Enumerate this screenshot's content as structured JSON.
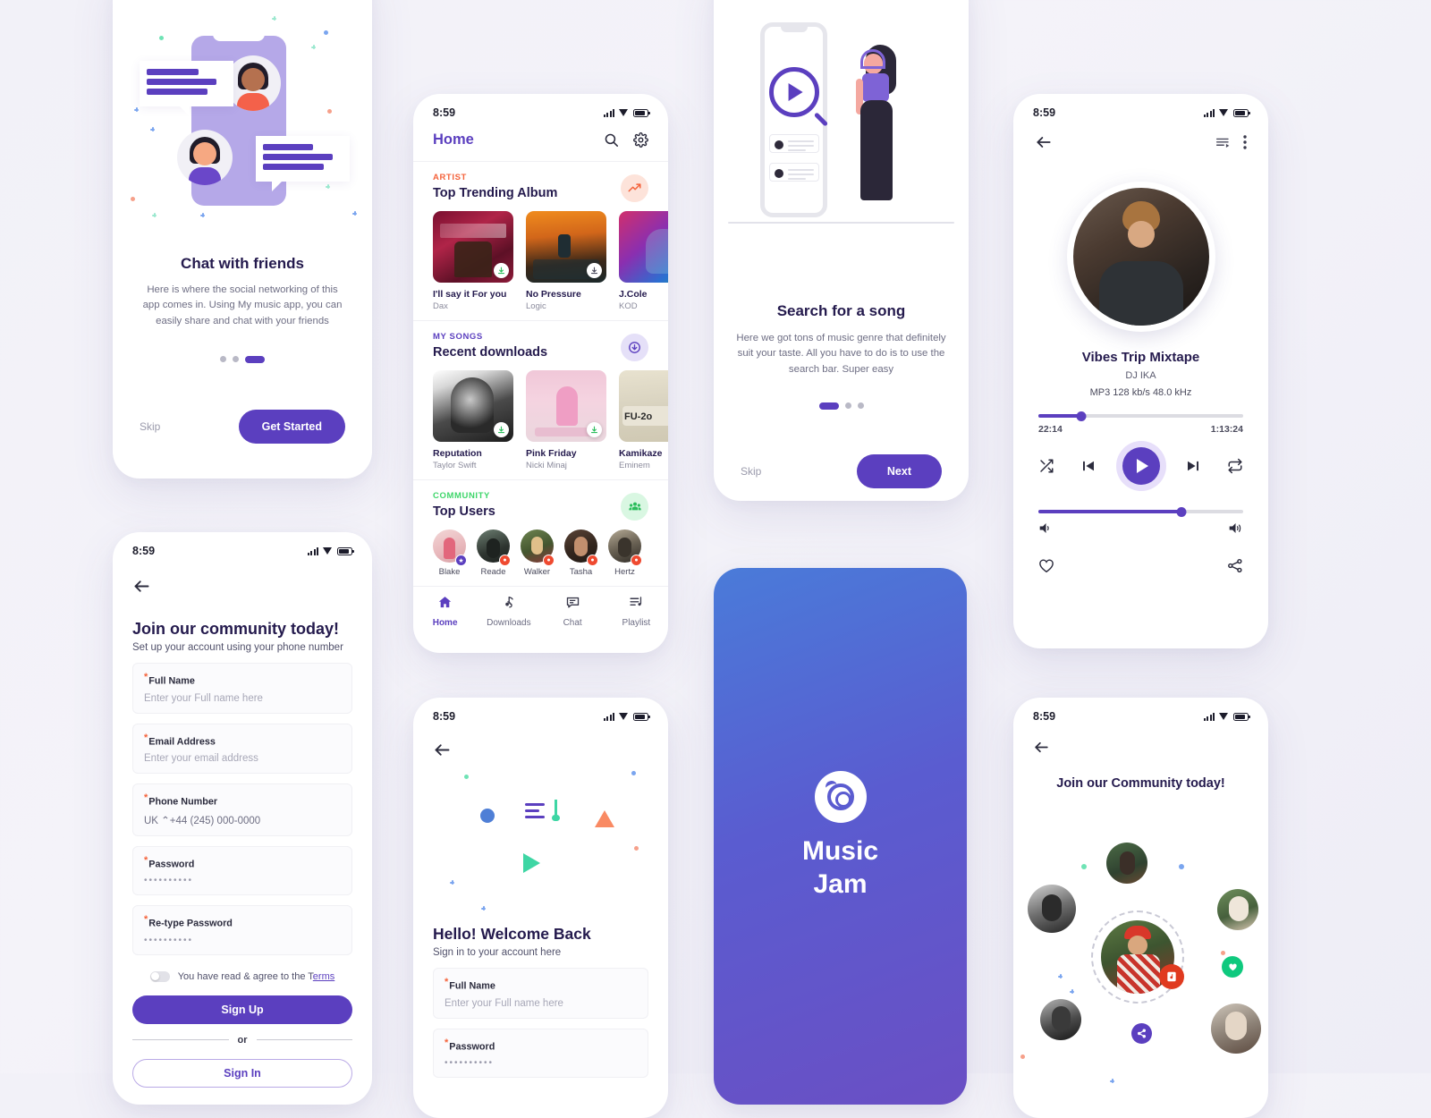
{
  "status_bar": {
    "time": "8:59"
  },
  "onboarding_chat": {
    "title": "Chat with friends",
    "description": "Here is where the social networking of this app comes in. Using My music app, you can easily share and chat with your friends",
    "skip_label": "Skip",
    "cta_label": "Get Started",
    "active_dot_index": 2
  },
  "onboarding_search": {
    "title": "Search for a song",
    "description": "Here we got tons of music genre that definitely suit your taste. All you have to do is to use the search bar. Super easy",
    "skip_label": "Skip",
    "cta_label": "Next",
    "active_dot_index": 0
  },
  "home": {
    "header_title": "Home",
    "sections": [
      {
        "kicker": "ARTIST",
        "kicker_color": "#f4623a",
        "title": "Top Trending Album",
        "badge_icon": "trending-up-icon",
        "badge_bg": "#fde3da",
        "badge_color": "#f4623a",
        "items": [
          {
            "name": "I'll say it For you",
            "artist": "Dax"
          },
          {
            "name": "No Pressure",
            "artist": "Logic"
          },
          {
            "name": "J.Cole",
            "artist": "KOD"
          }
        ]
      },
      {
        "kicker": "MY SONGS",
        "kicker_color": "#5b3fbf",
        "title": "Recent downloads",
        "badge_icon": "download-cloud-icon",
        "badge_bg": "#e5e0f8",
        "badge_color": "#5b3fbf",
        "items": [
          {
            "name": "Reputation",
            "artist": "Taylor Swift"
          },
          {
            "name": "Pink Friday",
            "artist": "Nicki Minaj"
          },
          {
            "name": "Kamikaze",
            "artist": "Eminem"
          }
        ]
      },
      {
        "kicker": "COMMUNITY",
        "kicker_color": "#3ed66a",
        "title": "Top Users",
        "badge_icon": "people-group-icon",
        "badge_bg": "#d9f7e2",
        "badge_color": "#2bbd5c"
      }
    ],
    "top_users": [
      {
        "name": "Blake",
        "badge": "star",
        "badge_color": "#5b3fbf"
      },
      {
        "name": "Reade",
        "badge": "fire",
        "badge_color": "#ef4a30"
      },
      {
        "name": "Walker",
        "badge": "fire",
        "badge_color": "#ef4a30"
      },
      {
        "name": "Tasha",
        "badge": "fire",
        "badge_color": "#ef4a30"
      },
      {
        "name": "Hertz",
        "badge": "fire",
        "badge_color": "#ef4a30"
      }
    ],
    "tabs": [
      {
        "label": "Home",
        "icon": "home-icon",
        "active": true
      },
      {
        "label": "Downloads",
        "icon": "download-music-icon",
        "active": false
      },
      {
        "label": "Chat",
        "icon": "chat-bubble-icon",
        "active": false
      },
      {
        "label": "Playlist",
        "icon": "playlist-icon",
        "active": false
      }
    ]
  },
  "player": {
    "track_title": "Vibes Trip Mixtape",
    "artist": "DJ IKA",
    "format": "MP3 128 kb/s 48.0 kHz",
    "elapsed": "22:14",
    "duration": "1:13:24",
    "progress_percent": 21,
    "volume_percent": 70,
    "icons": {
      "back": "back-arrow-icon",
      "queue": "queue-list-icon",
      "more": "more-vertical-icon",
      "shuffle": "shuffle-icon",
      "previous": "previous-track-icon",
      "play": "play-icon",
      "next": "next-track-icon",
      "repeat": "repeat-icon",
      "volume_low": "volume-low-icon",
      "volume_high": "volume-high-icon",
      "like": "heart-icon",
      "share": "share-icon"
    }
  },
  "signup": {
    "title": "Join our community today!",
    "subtitle": "Set up your account using your phone number",
    "fields": [
      {
        "label": "Full Name",
        "value": "Enter your Full name here",
        "type": "placeholder"
      },
      {
        "label": "Email Address",
        "value": "Enter your email address",
        "type": "placeholder"
      },
      {
        "label": "Phone Number",
        "value": "UK ⌃+44 (245) 000-0000",
        "type": "filled"
      },
      {
        "label": "Password",
        "value": "••••••••••",
        "type": "masked"
      },
      {
        "label": "Re-type Password",
        "value": "••••••••••",
        "type": "masked"
      }
    ],
    "agree_text": "You have read & agree to the T",
    "agree_link": "erms",
    "primary_button": "Sign Up",
    "divider_label": "or",
    "secondary_button": "Sign In"
  },
  "signin": {
    "title": "Hello! Welcome Back",
    "subtitle": "Sign in to your account here",
    "fields": [
      {
        "label": "Full Name",
        "value": "Enter your Full name here",
        "type": "placeholder"
      },
      {
        "label": "Password",
        "value": "••••••••••",
        "type": "masked"
      }
    ]
  },
  "splash": {
    "brand_line1": "Music",
    "brand_line2": "Jam",
    "logo_icon": "music-jam-logo-icon",
    "gradient_from": "#4a7bd9",
    "gradient_to": "#6a4fc4"
  },
  "community": {
    "title": "Join our Community today!",
    "fabs": [
      {
        "icon": "music-note-badge-icon",
        "color": "#e03a1f"
      },
      {
        "icon": "heart-badge-icon",
        "color": "#0fc97e"
      },
      {
        "icon": "share-badge-icon",
        "color": "#5b3fbf"
      }
    ]
  },
  "theme": {
    "accent": "#5b3fbf",
    "dark_text": "#241a4d",
    "muted_text": "#6e6e84",
    "orange": "#f4623a",
    "green": "#3ed66a",
    "page_bg": "#f2f1f8"
  }
}
